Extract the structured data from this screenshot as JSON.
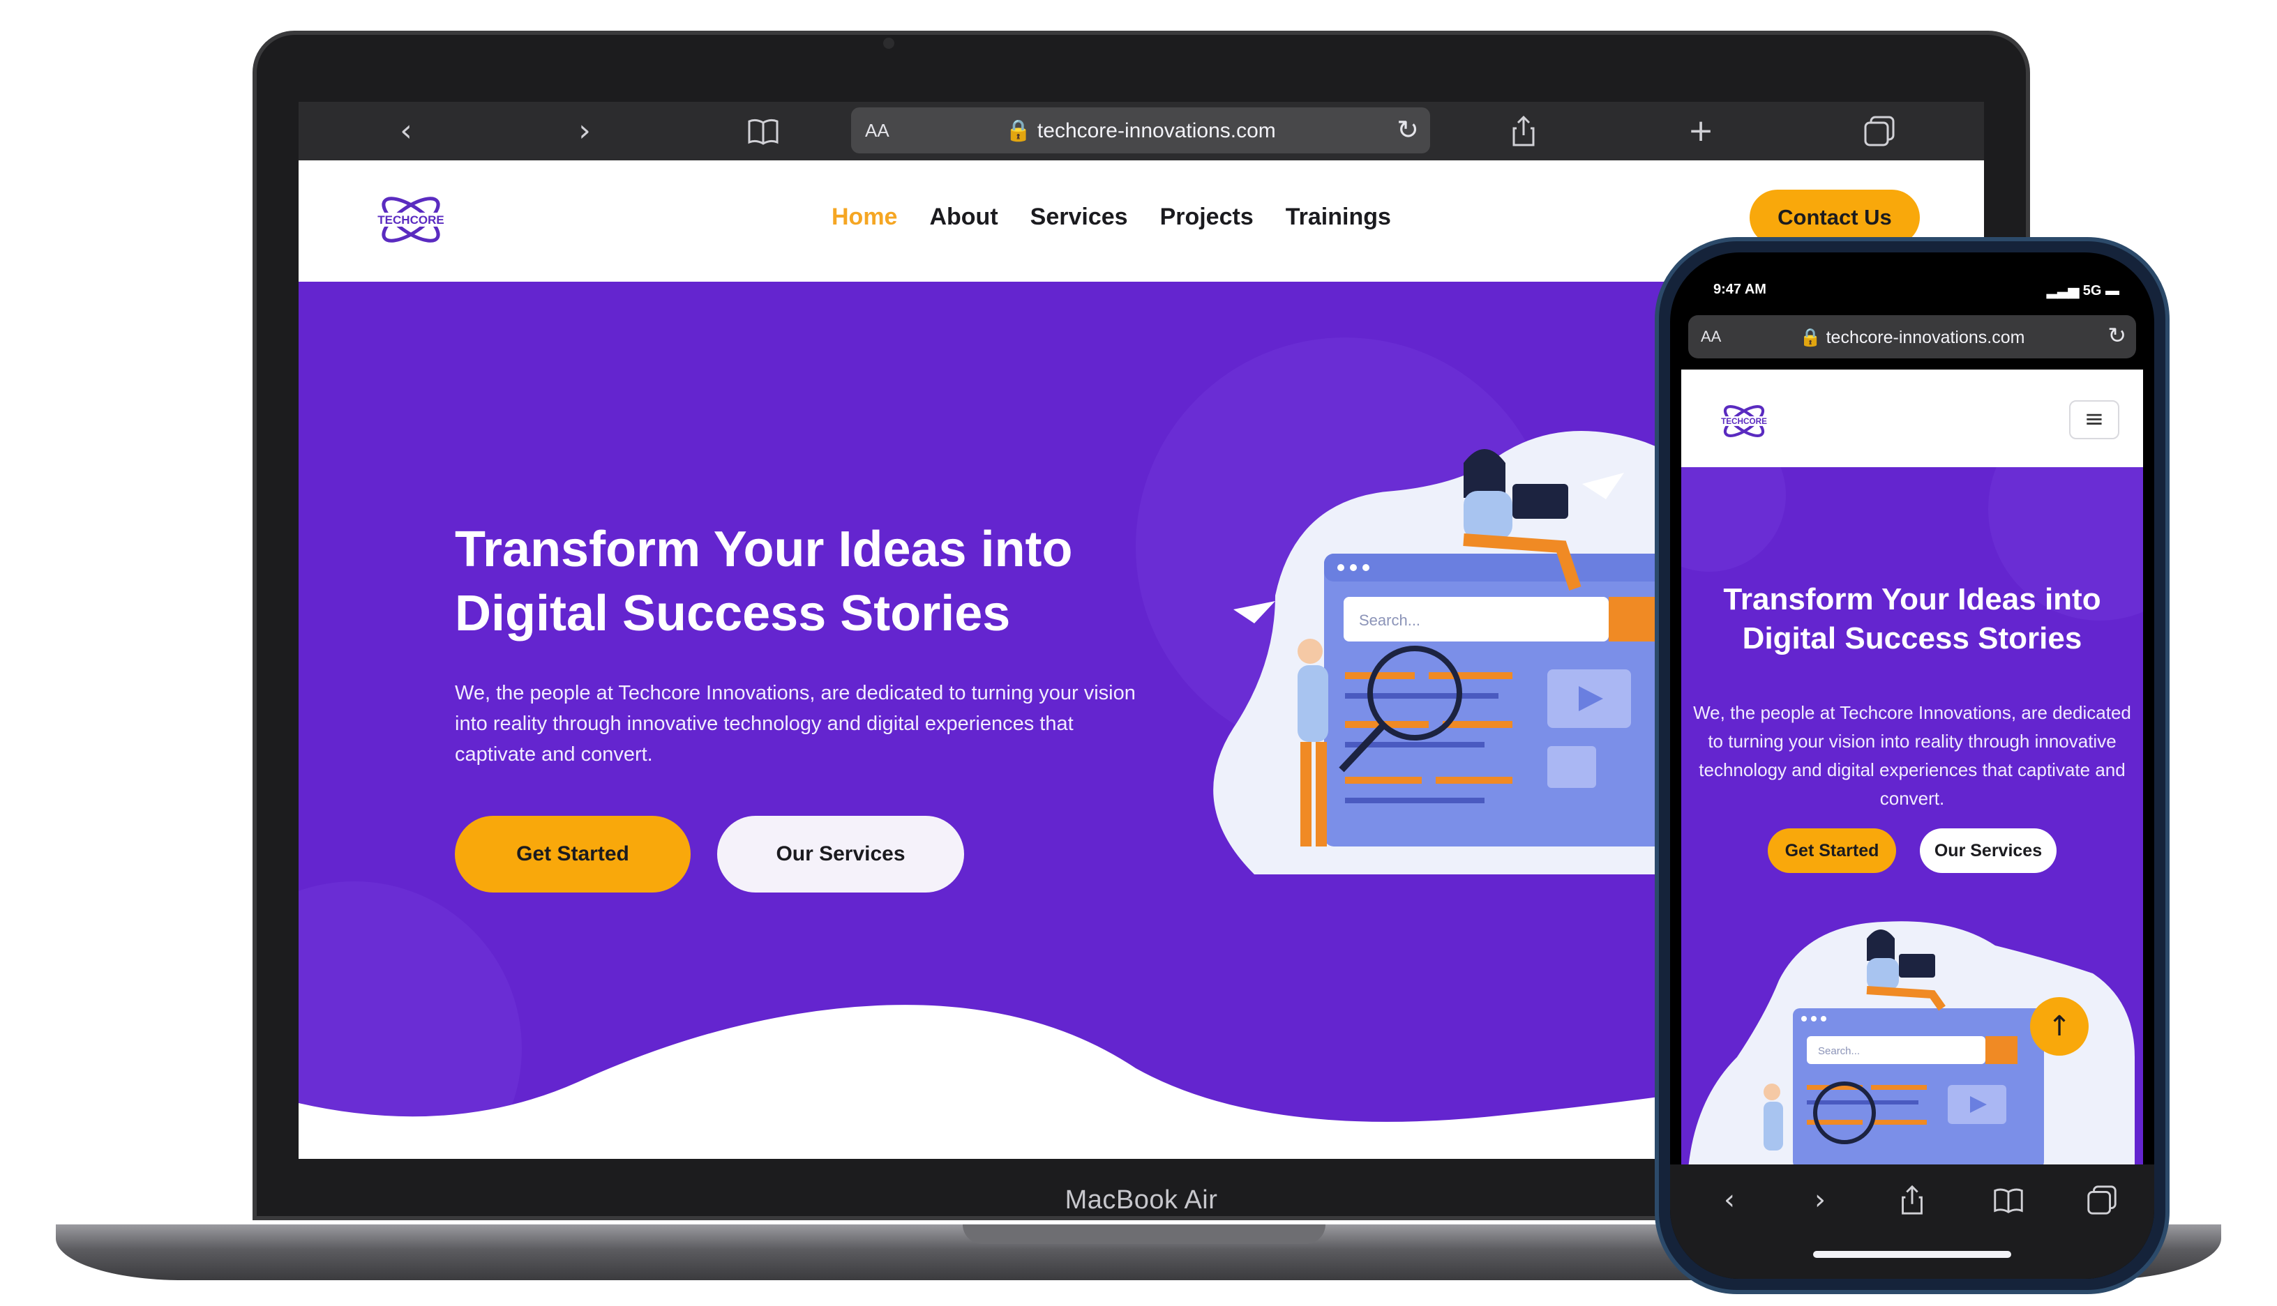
{
  "laptop": {
    "label": "MacBook Air",
    "browser": {
      "text_size": "AA",
      "url": "🔒 techcore-innovations.com",
      "icons": [
        "back-icon",
        "forward-icon",
        "bookmarks-icon",
        "reload-icon",
        "share-icon",
        "new-tab-icon",
        "tabs-icon"
      ]
    },
    "nav": {
      "links": [
        "Home",
        "About",
        "Services",
        "Projects",
        "Trainings"
      ],
      "active": "Home",
      "contact_label": "Contact Us"
    },
    "hero": {
      "title_line1": "Transform Your Ideas into",
      "title_line2": "Digital Success Stories",
      "description": "We, the people at Techcore Innovations, are dedicated to turning your vision into reality through innovative technology and digital experiences that captivate and convert.",
      "primary_button": "Get Started",
      "secondary_button": "Our Services",
      "search_placeholder": "Search..."
    }
  },
  "phone": {
    "status": {
      "time": "9:47 AM",
      "network": "5G"
    },
    "browser": {
      "text_size": "AA",
      "url": "🔒 techcore-innovations.com"
    },
    "hero": {
      "title": "Transform Your Ideas into Digital Success Stories",
      "description": "We, the people at Techcore Innovations, are dedicated to turning your vision into reality through innovative technology and digital experiences that captivate and convert.",
      "primary_button": "Get Started",
      "secondary_button": "Our Services",
      "search_placeholder": "Search..."
    }
  },
  "colors": {
    "brand_purple": "#6425cf",
    "accent_orange": "#f9a80b",
    "nav_active": "#f5a623"
  }
}
